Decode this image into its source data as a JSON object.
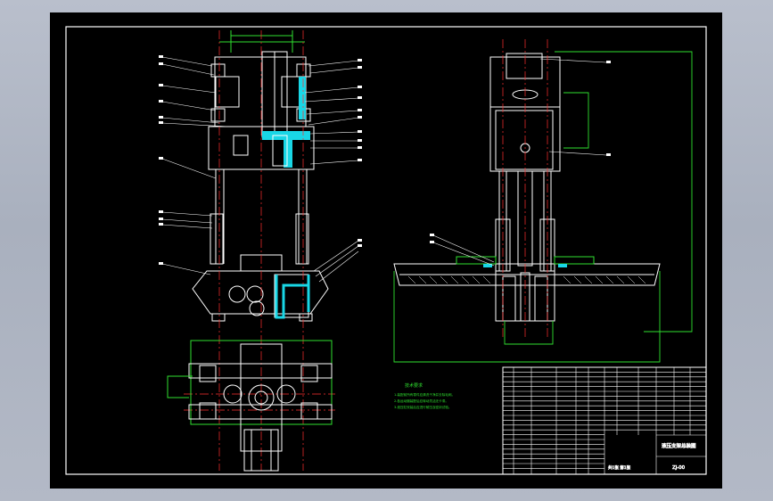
{
  "viewer": {
    "background_color": "#aeb5c2",
    "canvas_color": "#000000"
  },
  "drawing": {
    "colors": {
      "outline": "#ffffff",
      "centerline": "#ff3030",
      "dimension": "#2fe02f",
      "section_fill": "#19d7e6",
      "hatch": "#ffffff",
      "leader": "#ffffff"
    },
    "views": {
      "front": {
        "name": "front-section-view"
      },
      "side": {
        "name": "side-view"
      },
      "plan": {
        "name": "plan-view"
      }
    },
    "notes": {
      "title": "技术要求",
      "lines": [
        "1.装配前所有零件应清洗干净并去除毛刺。",
        "2.各运动副装配后应转动灵活无卡滞。",
        "3.液压缸安装后应进行耐压及密封试验。"
      ]
    },
    "title_block": {
      "drawing_name": "液压支架总装图",
      "drawing_number": "ZJ-00",
      "sheet_label": "共1张 第1张"
    }
  }
}
